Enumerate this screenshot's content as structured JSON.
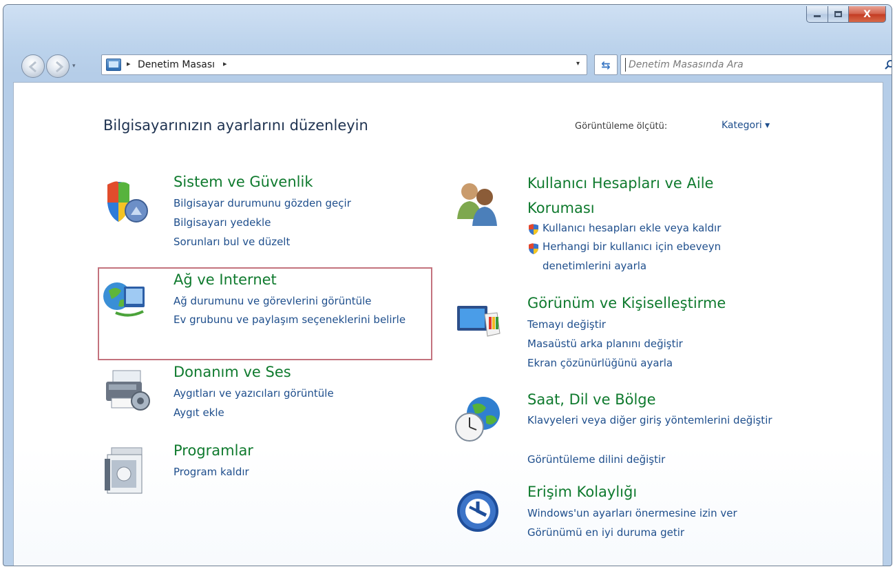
{
  "window": {
    "minimize_icon": "minimize-icon",
    "maximize_icon": "maximize-icon",
    "close_label": "X"
  },
  "address_bar": {
    "breadcrumb": "Denetim Masası",
    "separator": "▸",
    "dropdown": "▾"
  },
  "refresh": {
    "label": "⇆"
  },
  "search": {
    "placeholder": "Denetim Masasında Ara",
    "icon": "search-icon"
  },
  "header": {
    "title": "Bilgisayarınızın ayarlarını düzenleyin",
    "view_by_label": "Görüntüleme ölçütü:",
    "view_by_value": "Kategori ▾"
  },
  "categories_left": [
    {
      "title": "Sistem ve Güvenlik",
      "icon": "security-shield-icon",
      "links": [
        "Bilgisayar durumunu gözden geçir",
        "Bilgisayarı yedekle",
        "Sorunları bul ve düzelt"
      ]
    },
    {
      "title": "Ağ ve Internet",
      "icon": "network-globe-icon",
      "links": [
        "Ağ durumunu ve görevlerini görüntüle",
        "Ev grubunu ve paylaşım seçeneklerini belirle"
      ]
    },
    {
      "title": "Donanım ve Ses",
      "icon": "printer-icon",
      "links": [
        "Aygıtları ve yazıcıları görüntüle",
        "Aygıt ekle"
      ]
    },
    {
      "title": "Programlar",
      "icon": "programs-icon",
      "links": [
        "Program kaldır"
      ]
    }
  ],
  "categories_right": [
    {
      "title": "Kullanıcı Hesapları ve Aile Koruması",
      "icon": "users-icon",
      "links": [
        "Kullanıcı hesapları ekle veya kaldır",
        "Herhangi bir kullanıcı için ebeveyn denetimlerini ayarla"
      ]
    },
    {
      "title": "Görünüm ve Kişiselleştirme",
      "icon": "personalization-icon",
      "links": [
        "Temayı değiştir",
        "Masaüstü arka planını değiştir",
        "Ekran çözünürlüğünü ayarla"
      ]
    },
    {
      "title": "Saat, Dil ve Bölge",
      "icon": "clock-globe-icon",
      "links": [
        "Klavyeleri veya diğer giriş yöntemlerini değiştir",
        "Görüntüleme dilini değiştir"
      ]
    },
    {
      "title": "Erişim Kolaylığı",
      "icon": "ease-of-access-icon",
      "links": [
        "Windows'un ayarları önermesine izin ver",
        "Görünümü en iyi duruma getir"
      ]
    }
  ],
  "colors": {
    "category_title": "#0f7a2e",
    "link": "#1e4e8c",
    "highlight_border": "#c3727d"
  }
}
